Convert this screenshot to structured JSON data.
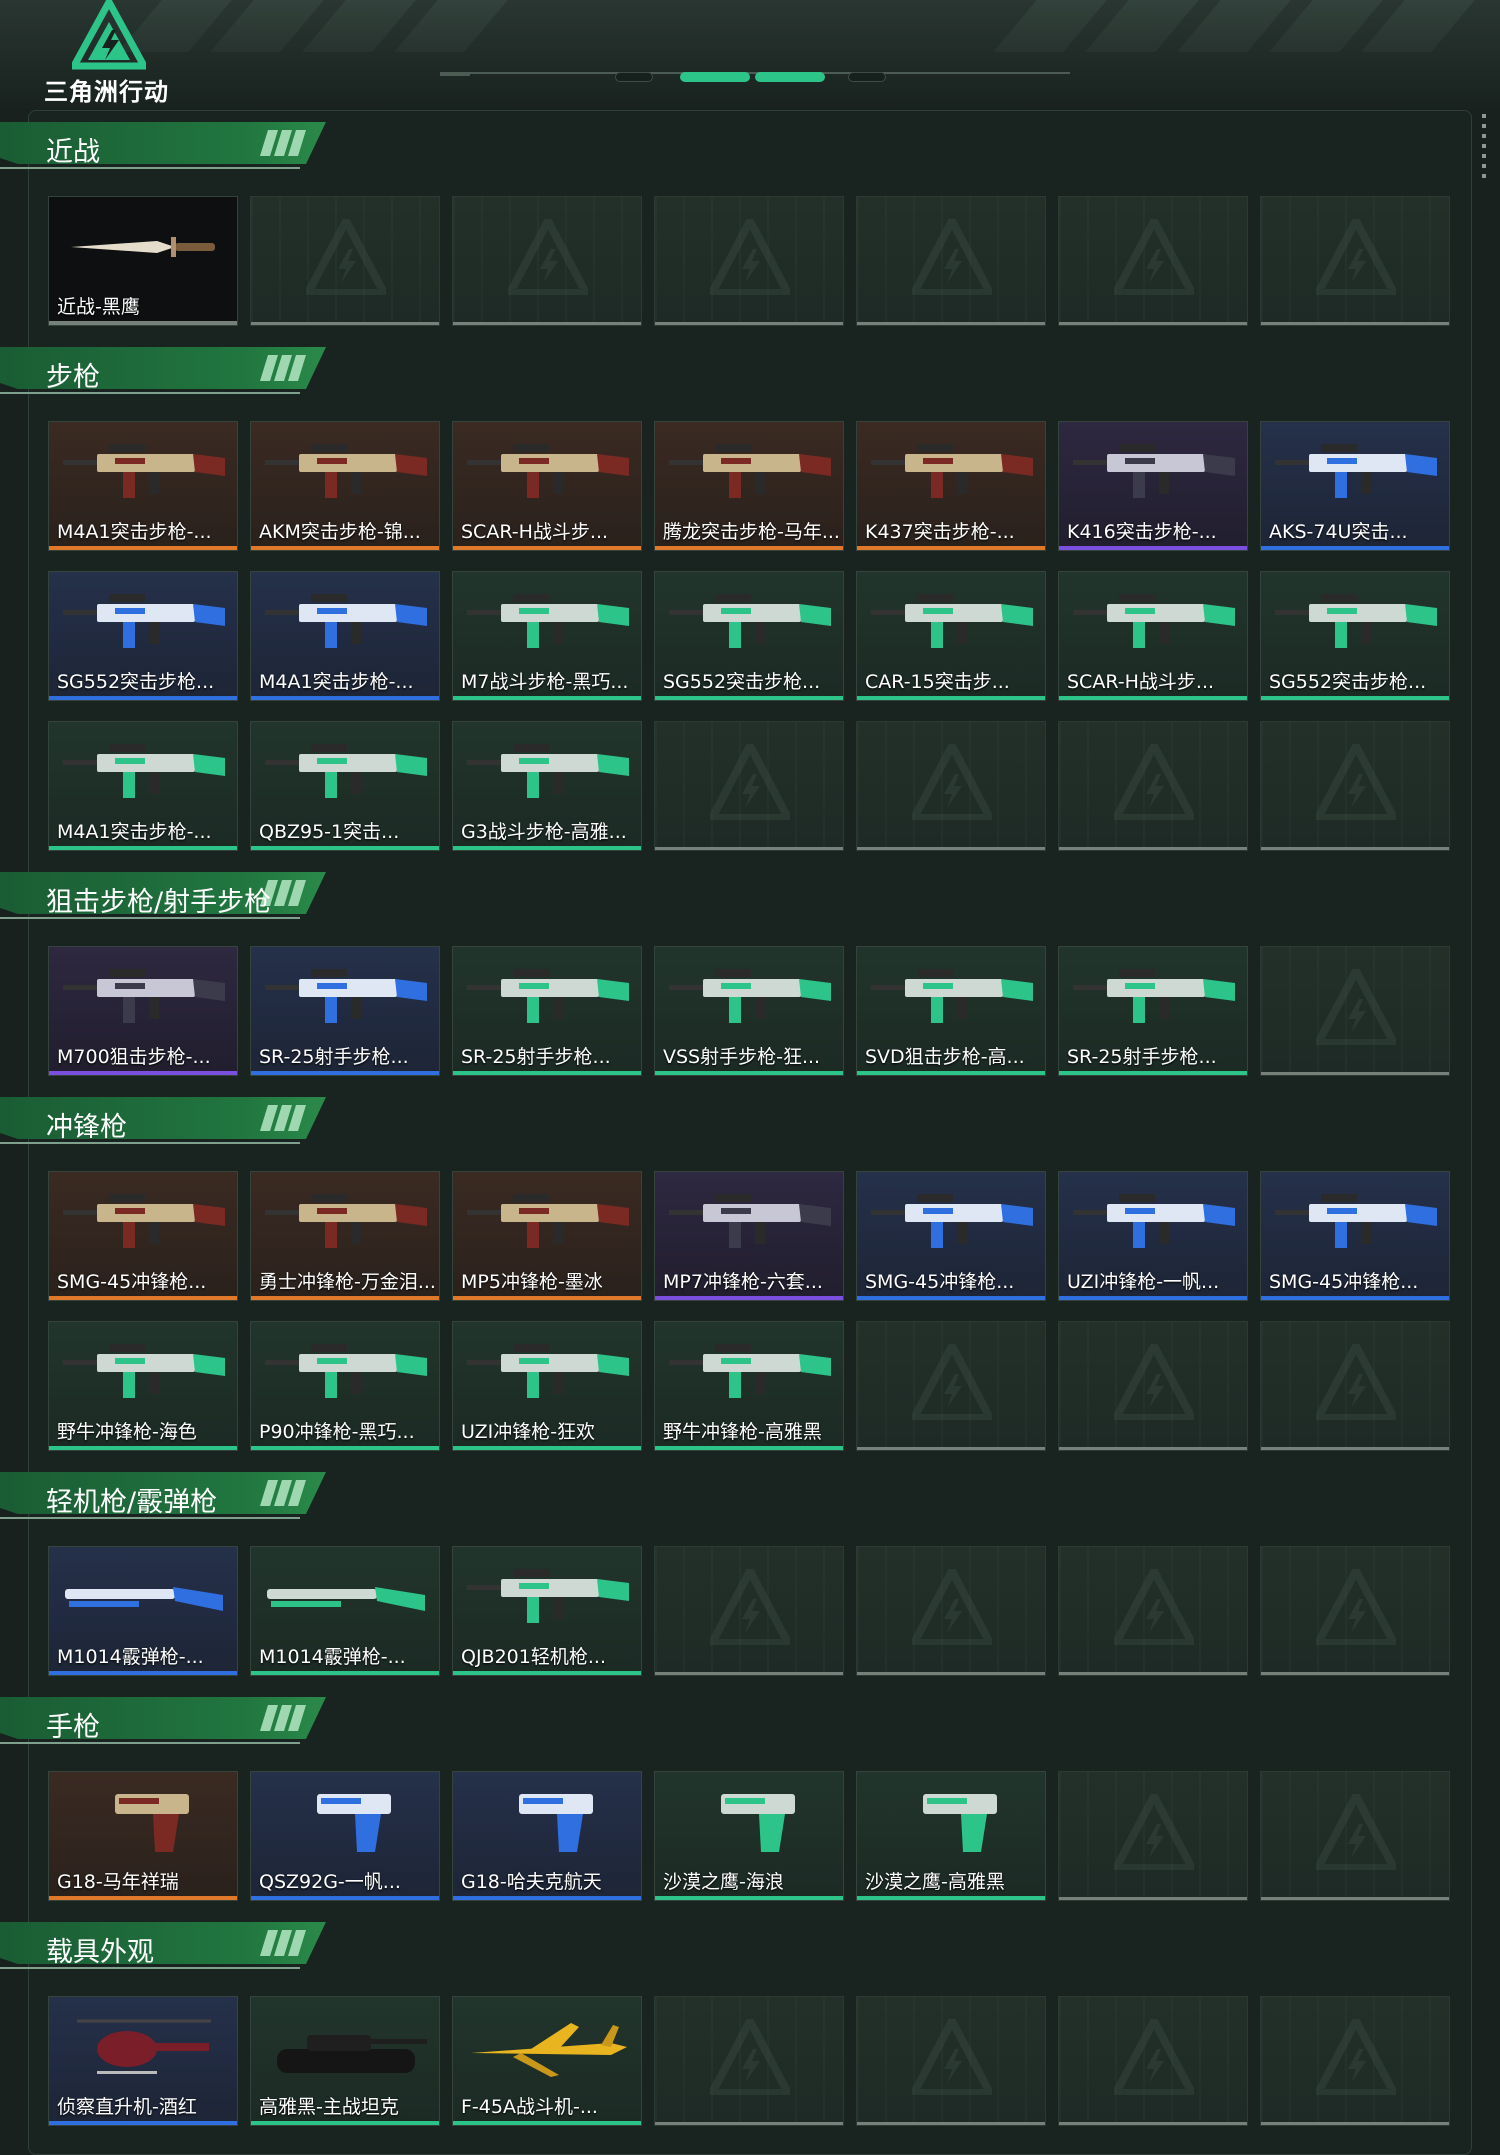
{
  "brand": {
    "logo_text": "三角洲行动",
    "accent": "#2dc48a"
  },
  "colors": {
    "orange": "#e07a2a",
    "purple": "#7b4fe0",
    "blue": "#2f6fe0",
    "green": "#2dc48a",
    "gray": "#77817c"
  },
  "sections": [
    {
      "title": "近战",
      "items": [
        {
          "label": "近战-黑鹰",
          "tier": "black",
          "icon": "knife-icon"
        }
      ]
    },
    {
      "title": "步枪",
      "items": [
        {
          "label": "M4A1突击步枪-...",
          "tier": "orange",
          "icon": "assault-rifle-icon"
        },
        {
          "label": "AKM突击步枪-锦...",
          "tier": "orange",
          "icon": "assault-rifle-icon"
        },
        {
          "label": "SCAR-H战斗步...",
          "tier": "orange",
          "icon": "assault-rifle-icon"
        },
        {
          "label": "腾龙突击步枪-马年...",
          "tier": "orange",
          "icon": "assault-rifle-icon"
        },
        {
          "label": "K437突击步枪-...",
          "tier": "orange",
          "icon": "assault-rifle-icon"
        },
        {
          "label": "K416突击步枪-...",
          "tier": "purple",
          "icon": "assault-rifle-icon"
        },
        {
          "label": "AKS-74U突击...",
          "tier": "blue",
          "icon": "assault-rifle-icon"
        },
        {
          "label": "SG552突击步枪...",
          "tier": "blue",
          "icon": "assault-rifle-icon"
        },
        {
          "label": "M4A1突击步枪-...",
          "tier": "blue",
          "icon": "assault-rifle-icon"
        },
        {
          "label": "M7战斗步枪-黑巧...",
          "tier": "green",
          "icon": "assault-rifle-icon"
        },
        {
          "label": "SG552突击步枪...",
          "tier": "green",
          "icon": "assault-rifle-icon"
        },
        {
          "label": "CAR-15突击步...",
          "tier": "green",
          "icon": "assault-rifle-icon"
        },
        {
          "label": "SCAR-H战斗步...",
          "tier": "green",
          "icon": "assault-rifle-icon"
        },
        {
          "label": "SG552突击步枪...",
          "tier": "green",
          "icon": "assault-rifle-icon"
        },
        {
          "label": "M4A1突击步枪-...",
          "tier": "green",
          "icon": "assault-rifle-icon"
        },
        {
          "label": "QBZ95-1突击...",
          "tier": "green",
          "icon": "assault-rifle-icon"
        },
        {
          "label": "G3战斗步枪-高雅...",
          "tier": "green",
          "icon": "assault-rifle-icon"
        }
      ]
    },
    {
      "title": "狙击步枪/射手步枪",
      "items": [
        {
          "label": "M700狙击步枪-...",
          "tier": "purple",
          "icon": "sniper-rifle-icon"
        },
        {
          "label": "SR-25射手步枪...",
          "tier": "blue",
          "icon": "sniper-rifle-icon"
        },
        {
          "label": "SR-25射手步枪...",
          "tier": "green",
          "icon": "sniper-rifle-icon"
        },
        {
          "label": "VSS射手步枪-狂...",
          "tier": "green",
          "icon": "sniper-rifle-icon"
        },
        {
          "label": "SVD狙击步枪-高...",
          "tier": "green",
          "icon": "sniper-rifle-icon"
        },
        {
          "label": "SR-25射手步枪...",
          "tier": "green",
          "icon": "sniper-rifle-icon"
        }
      ]
    },
    {
      "title": "冲锋枪",
      "items": [
        {
          "label": "SMG-45冲锋枪...",
          "tier": "orange",
          "icon": "smg-icon"
        },
        {
          "label": "勇士冲锋枪-万金泪...",
          "tier": "orange",
          "icon": "smg-icon"
        },
        {
          "label": "MP5冲锋枪-墨冰",
          "tier": "orange",
          "icon": "smg-icon"
        },
        {
          "label": "MP7冲锋枪-六套...",
          "tier": "purple",
          "icon": "smg-icon"
        },
        {
          "label": "SMG-45冲锋枪...",
          "tier": "blue",
          "icon": "smg-icon"
        },
        {
          "label": "UZI冲锋枪-一帆...",
          "tier": "blue",
          "icon": "smg-icon"
        },
        {
          "label": "SMG-45冲锋枪...",
          "tier": "blue",
          "icon": "smg-icon"
        },
        {
          "label": "野牛冲锋枪-海色",
          "tier": "green",
          "icon": "smg-icon"
        },
        {
          "label": "P90冲锋枪-黑巧...",
          "tier": "green",
          "icon": "smg-icon"
        },
        {
          "label": "UZI冲锋枪-狂欢",
          "tier": "green",
          "icon": "smg-icon"
        },
        {
          "label": "野牛冲锋枪-高雅黑",
          "tier": "green",
          "icon": "smg-icon"
        }
      ]
    },
    {
      "title": "轻机枪/霰弹枪",
      "items": [
        {
          "label": "M1014霰弹枪-...",
          "tier": "blue",
          "icon": "shotgun-icon"
        },
        {
          "label": "M1014霰弹枪-...",
          "tier": "green",
          "icon": "shotgun-icon"
        },
        {
          "label": "QJB201轻机枪...",
          "tier": "green",
          "icon": "machine-gun-icon"
        }
      ]
    },
    {
      "title": "手枪",
      "items": [
        {
          "label": "G18-马年祥瑞",
          "tier": "orange",
          "icon": "pistol-icon"
        },
        {
          "label": "QSZ92G-一帆...",
          "tier": "blue",
          "icon": "pistol-icon"
        },
        {
          "label": "G18-哈夫克航天",
          "tier": "blue",
          "icon": "pistol-icon"
        },
        {
          "label": "沙漠之鹰-海浪",
          "tier": "green",
          "icon": "pistol-icon"
        },
        {
          "label": "沙漠之鹰-高雅黑",
          "tier": "green",
          "icon": "pistol-icon"
        }
      ]
    },
    {
      "title": "载具外观",
      "items": [
        {
          "label": "侦察直升机-酒红",
          "tier": "blue",
          "icon": "helicopter-icon"
        },
        {
          "label": "高雅黑-主战坦克",
          "tier": "green",
          "icon": "tank-icon"
        },
        {
          "label": "F-45A战斗机-...",
          "tier": "green",
          "icon": "fighter-jet-icon"
        }
      ]
    }
  ]
}
